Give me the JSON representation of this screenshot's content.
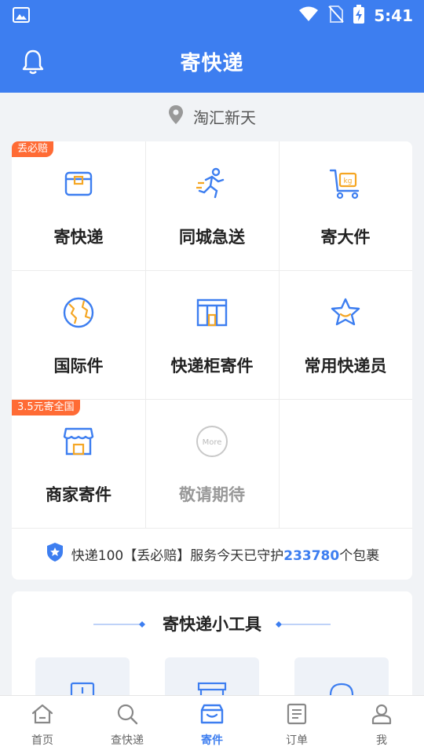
{
  "status_bar": {
    "time": "5:41"
  },
  "app_bar": {
    "title": "寄快递"
  },
  "location": {
    "text": "淘汇新天"
  },
  "services": {
    "items": [
      {
        "label": "寄快递",
        "badge": "丢必赔"
      },
      {
        "label": "同城急送"
      },
      {
        "label": "寄大件"
      },
      {
        "label": "国际件"
      },
      {
        "label": "快递柜寄件"
      },
      {
        "label": "常用快递员"
      },
      {
        "label": "商家寄件",
        "badge": "3.5元寄全国"
      },
      {
        "label": "敬请期待"
      }
    ],
    "guarantee": {
      "prefix": "快递100【丢必赔】服务今天已守护",
      "count": "233780",
      "suffix": "个包裹"
    }
  },
  "tools": {
    "title": "寄快递小工具"
  },
  "bottom_nav": [
    {
      "label": "首页"
    },
    {
      "label": "查快递"
    },
    {
      "label": "寄件",
      "active": true
    },
    {
      "label": "订单"
    },
    {
      "label": "我"
    }
  ],
  "colors": {
    "primary": "#3d7ef0",
    "badge": "#ff6b35",
    "icon_orange": "#f5a623"
  }
}
